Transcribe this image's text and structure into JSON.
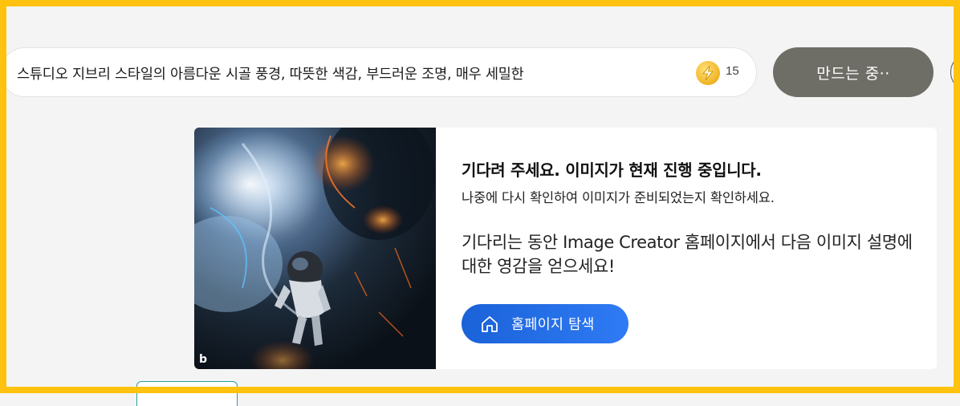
{
  "prompt": {
    "value": "스튜디오 지브리 스타일의 아름다운 시골 풍경, 따뜻한 색감, 부드러운 조명, 매우 세밀한",
    "boost_count": "15",
    "boost_icon": "lightning-coin-icon"
  },
  "create_button": {
    "label": "만드는 중··"
  },
  "status_card": {
    "title": "기다려 주세요. 이미지가 현재 진행 중입니다.",
    "subtitle": "나중에 다시 확인하여 이미지가 준비되었는지 확인하세요.",
    "inspiration": "기다리는 동안 Image Creator 홈페이지에서 다음 이미지 설명에 대한 영감을 얻으세요!",
    "explore_button": {
      "label": "홈페이지 탐색",
      "icon": "home-icon"
    },
    "image": {
      "watermark": "b",
      "subject": "astronaut-in-nebula"
    }
  },
  "colors": {
    "highlight_border": "#ffc20e",
    "create_button_bg": "#6e6d66",
    "explore_button_bg": "#1a62d8",
    "coin": "#f0b323"
  }
}
